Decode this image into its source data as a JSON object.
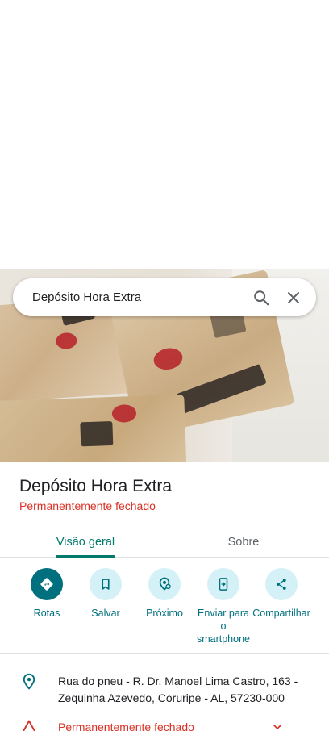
{
  "search": {
    "query": "Depósito Hora Extra"
  },
  "place": {
    "title": "Depósito Hora Extra",
    "status": "Permanentemente fechado"
  },
  "tabs": [
    {
      "label": "Visão geral",
      "active": true
    },
    {
      "label": "Sobre",
      "active": false
    }
  ],
  "actions": [
    {
      "label": "Rotas",
      "icon": "directions-icon"
    },
    {
      "label": "Salvar",
      "icon": "bookmark-icon"
    },
    {
      "label": "Próximo",
      "icon": "nearby-icon"
    },
    {
      "label": "Enviar para o smartphone",
      "icon": "send-to-phone-icon"
    },
    {
      "label": "Compartilhar",
      "icon": "share-icon"
    }
  ],
  "details": {
    "address": "Rua do pneu - R. Dr. Manoel Lima Castro, 163 - Zequinha Azevedo, Coruripe - AL, 57230-000",
    "hours_status": "Permanentemente fechado"
  },
  "colors": {
    "accent": "#00707e",
    "tab_accent": "#00796b",
    "closed_red": "#d93025",
    "action_bg": "#d4f1f7"
  }
}
